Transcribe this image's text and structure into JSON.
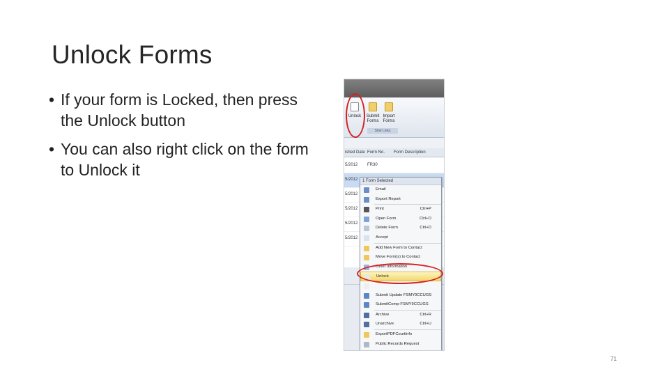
{
  "slide": {
    "title": "Unlock Forms",
    "bullets": [
      "If your form is Locked, then press the Unlock button",
      "You can also right click on the form to Unlock it"
    ],
    "page_number": "71"
  },
  "screenshot": {
    "ribbon": {
      "buttons": [
        {
          "label": "Unlock",
          "icon": "document-icon"
        },
        {
          "label": "Submit Forms",
          "icon": "folder-icon"
        },
        {
          "label": "Import Forms",
          "icon": "folder-gear-icon"
        }
      ],
      "group_label": "Shel Links"
    },
    "grid": {
      "columns": [
        "ished Date",
        "Form No.",
        "Form Description"
      ],
      "rows": [
        {
          "date": "5/2012",
          "form": "FR30",
          "selected": false
        },
        {
          "date": "5/2012",
          "form": "",
          "selected": true
        },
        {
          "date": "5/2012",
          "form": "",
          "selected": false
        },
        {
          "date": "5/2012",
          "form": "",
          "selected": false
        },
        {
          "date": "5/2012",
          "form": "",
          "selected": false
        },
        {
          "date": "5/2012",
          "form": "",
          "selected": false
        }
      ]
    },
    "context_menu": {
      "header": "1 Form Selected",
      "items": [
        {
          "label": "Email",
          "shortcut": "",
          "icon": "email-icon",
          "color": "#6b8fc4"
        },
        {
          "label": "Export Report",
          "shortcut": "",
          "icon": "export-icon",
          "color": "#6b8fc4"
        },
        {
          "sep": true
        },
        {
          "label": "Print",
          "shortcut": "Ctrl+P",
          "icon": "printer-icon",
          "color": "#555555"
        },
        {
          "label": "Open Form",
          "shortcut": "Ctrl+O",
          "icon": "open-form-icon",
          "color": "#7fa3d6"
        },
        {
          "label": "Delete Form",
          "shortcut": "Ctrl+D",
          "icon": "delete-icon",
          "color": "#b9c6d8"
        },
        {
          "label": "Accept",
          "shortcut": "",
          "icon": "accept-icon",
          "color": "#d9e2ee"
        },
        {
          "sep": true
        },
        {
          "label": "Add New Form to Contact",
          "shortcut": "",
          "icon": "add-folder-icon",
          "color": "#f0c85a"
        },
        {
          "label": "Move Form(s) to Contact",
          "shortcut": "",
          "icon": "move-folder-icon",
          "color": "#f0c85a"
        },
        {
          "label": "Other Information",
          "shortcut": "",
          "icon": "info-icon",
          "color": "#9bb3d6"
        },
        {
          "label": "Unlock",
          "shortcut": "",
          "icon": "unlock-icon",
          "color": "#e7e7e7",
          "highlighted": true
        },
        {
          "label": "",
          "shortcut": "",
          "icon": "blank-icon",
          "color": "#eeeeee"
        },
        {
          "label": "Submit Update FSMY9CCUGS",
          "shortcut": "",
          "icon": "submit-icon",
          "color": "#5e86c2"
        },
        {
          "label": "SubmitComp-FSMY9CCUGS",
          "shortcut": "",
          "icon": "submit-comp-icon",
          "color": "#5e86c2"
        },
        {
          "sep": true
        },
        {
          "label": "Archive",
          "shortcut": "Ctrl+R",
          "icon": "archive-icon",
          "color": "#4e6fa0"
        },
        {
          "label": "Unarchive",
          "shortcut": "Ctrl+U",
          "icon": "unarchive-icon",
          "color": "#4e6fa0"
        },
        {
          "sep": true
        },
        {
          "label": "ExportPDFCourtInfo",
          "shortcut": "",
          "icon": "pdf-folder-icon",
          "color": "#f0c85a"
        },
        {
          "label": "Public Records Request",
          "shortcut": "",
          "icon": "records-icon",
          "color": "#b0b8c6"
        }
      ]
    }
  }
}
